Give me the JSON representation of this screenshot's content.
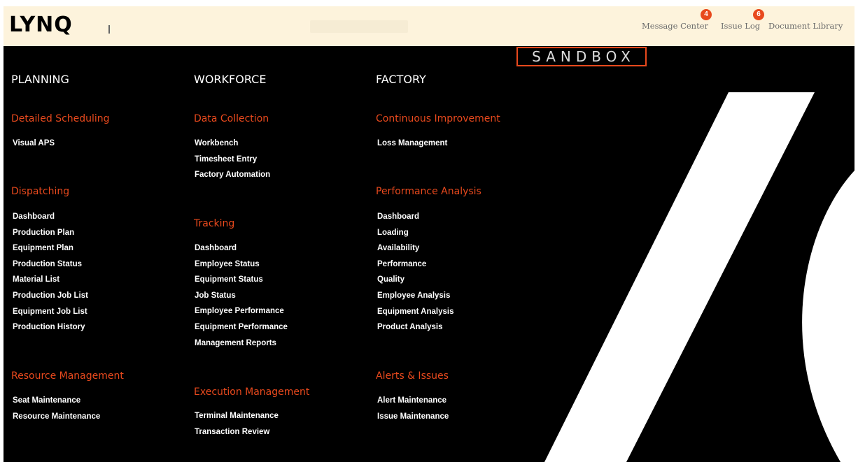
{
  "header": {
    "logo_text": "LYNQ",
    "links": [
      {
        "label": "Message Center",
        "badge": "4"
      },
      {
        "label": "Issue Log",
        "badge": "6"
      },
      {
        "label": "Document Library"
      }
    ],
    "colors": {
      "background": "#fdf3dc",
      "badge": "#e8491d",
      "link": "#6b6b6b"
    }
  },
  "sandbox_label": "SANDBOX",
  "columns": [
    {
      "title": "PLANNING",
      "sections": [
        {
          "title": "Detailed Scheduling",
          "items": [
            "Visual APS"
          ]
        },
        {
          "title": "Dispatching",
          "items": [
            "Dashboard",
            "Production Plan",
            "Equipment Plan",
            "Production Status",
            "Material List",
            "Production Job List",
            "Equipment Job List",
            "Production History"
          ]
        },
        {
          "title": "Resource Management",
          "items": [
            "Seat Maintenance",
            "Resource Maintenance"
          ]
        }
      ]
    },
    {
      "title": "WORKFORCE",
      "sections": [
        {
          "title": "Data Collection",
          "items": [
            "Workbench",
            "Timesheet Entry",
            "Factory Automation"
          ]
        },
        {
          "title": "Tracking",
          "items": [
            "Dashboard",
            "Employee Status",
            "Equipment Status",
            "Job Status",
            "Employee Performance",
            "Equipment Performance",
            "Management Reports"
          ]
        },
        {
          "title": "Execution Management",
          "items": [
            "Terminal Maintenance",
            "Transaction Review"
          ]
        }
      ]
    },
    {
      "title": "FACTORY",
      "sections": [
        {
          "title": "Continuous Improvement",
          "items": [
            "Loss Management"
          ]
        },
        {
          "title": "Performance Analysis",
          "items": [
            "Dashboard",
            "Loading",
            "Availability",
            "Performance",
            "Quality",
            "Employee Analysis",
            "Equipment Analysis",
            "Product Analysis"
          ]
        },
        {
          "title": "Alerts & Issues",
          "items": [
            "Alert Maintenance",
            "Issue Maintenance"
          ]
        }
      ]
    }
  ],
  "theme": {
    "background": "#000000",
    "accent": "#e8491d",
    "text": "#ffffff"
  }
}
